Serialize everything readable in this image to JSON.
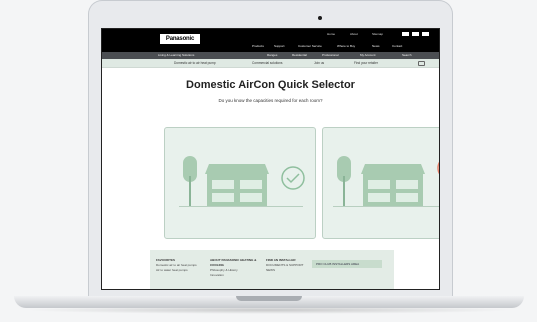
{
  "header": {
    "brand": "Panasonic",
    "util_links": [
      "Home",
      "About",
      "Sitemap"
    ],
    "main_nav": [
      "Products",
      "Support",
      "Customer Service",
      "Where to Buy",
      "News",
      "Contact"
    ],
    "gray_left": "Living & Learning Solutions",
    "gray_links": [
      "Ranges",
      "Residential",
      "Professional",
      "My Account",
      "Search"
    ]
  },
  "subnav": [
    "Domestic air to air heat pump",
    "Commercial solutions",
    "Join us",
    "Find your retailer"
  ],
  "main": {
    "title": "Domestic AirCon Quick Selector",
    "subtitle": "Do you know the capacities required for each room?"
  },
  "cards": [
    {
      "answer": "yes",
      "badge_color": "#8fbf9e",
      "badge_icon": "check-icon"
    },
    {
      "answer": "no",
      "badge_color": "#e8826b",
      "badge_icon": "question-icon",
      "badge_text": "?"
    }
  ],
  "footer": {
    "col1_title": "FAVOURITES",
    "col1_items": [
      "Domestic air to air heat pumps",
      "Air to water heat pumps"
    ],
    "col2_title": "ABOUT PANASONIC HEATING & COOLING",
    "col2_items": [
      "Philosophy & History",
      "Innovation"
    ],
    "col3_title": "FIND AN INSTALLER",
    "col3_items": [
      "DOCUMENTS & SUPPORT",
      "NEWS"
    ],
    "cta": "PRO CLUB INSTALLERS AREA"
  },
  "colors": {
    "topbar": "#000000",
    "accent_green": "#8fbf9e",
    "card_bg": "#e8f1ec",
    "badge_orange": "#e8826b"
  }
}
